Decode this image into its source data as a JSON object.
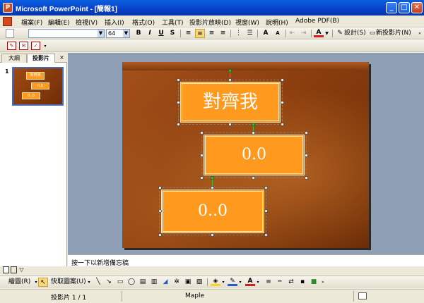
{
  "window": {
    "title": "Microsoft PowerPoint - [簡報1]",
    "min_label": "_",
    "max_label": "□",
    "close_label": "✕"
  },
  "menu": [
    {
      "label": "檔案(F)"
    },
    {
      "label": "編輯(E)"
    },
    {
      "label": "檢視(V)"
    },
    {
      "label": "插入(I)"
    },
    {
      "label": "格式(O)"
    },
    {
      "label": "工具(T)"
    },
    {
      "label": "投影片放映(D)"
    },
    {
      "label": "視窗(W)"
    },
    {
      "label": "說明(H)"
    },
    {
      "label": "Adobe PDF(B)"
    }
  ],
  "toolbar": {
    "font_name": "",
    "font_size": "64",
    "bold": "B",
    "italic": "I",
    "underline": "U",
    "shadow": "S",
    "grow_font": "A",
    "shrink_font": "A",
    "font_color": "A",
    "design_label": "設計(S)",
    "new_slide_label": "新投影片(N)"
  },
  "left_panel": {
    "tab_outline": "大綱",
    "tab_slides": "投影片",
    "close": "×",
    "slide_number": "1",
    "thumb_title": "對齊我",
    "thumb_box2": "0.0",
    "thumb_box3": "0..0"
  },
  "slide": {
    "title_text": "對齊我",
    "box2_text": "0.0",
    "box3_text": "0..0"
  },
  "notes": {
    "placeholder": "按一下以新增備忘稿"
  },
  "draw_toolbar": {
    "draw_label": "繪圖(R)",
    "autoshapes_label": "快取圖案(U)"
  },
  "status": {
    "slide_info": "投影片 1 / 1",
    "design_name": "Maple"
  },
  "colors": {
    "textbox_fill": "#FF9A1E",
    "title_bar": "#0A5FE0",
    "slide_bg": "#8B3E0E"
  }
}
